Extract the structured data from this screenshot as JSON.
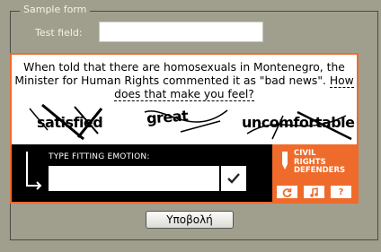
{
  "form": {
    "legend": "Sample form",
    "field_label": "Test field:",
    "field_value": "",
    "submit_label": "Υποβολή"
  },
  "captcha": {
    "question_part1": "When told that there are homosexuals in Montenegro, the Minister for Human Rights commented it as \"bad news\". ",
    "question_link": "How does that make you feel?",
    "words": [
      "satisfied",
      "great",
      "uncomfortable"
    ],
    "emotion_label": "TYPE FITTING EMOTION:",
    "answer_value": "",
    "brand_lines": [
      "CIVIL",
      "RIGHTS",
      "DEFENDERS"
    ],
    "icons": [
      "check-icon",
      "refresh-icon",
      "audio-icon",
      "help-icon"
    ],
    "tool_labels": [
      "?"
    ],
    "accent_color": "#ee6b2b"
  }
}
